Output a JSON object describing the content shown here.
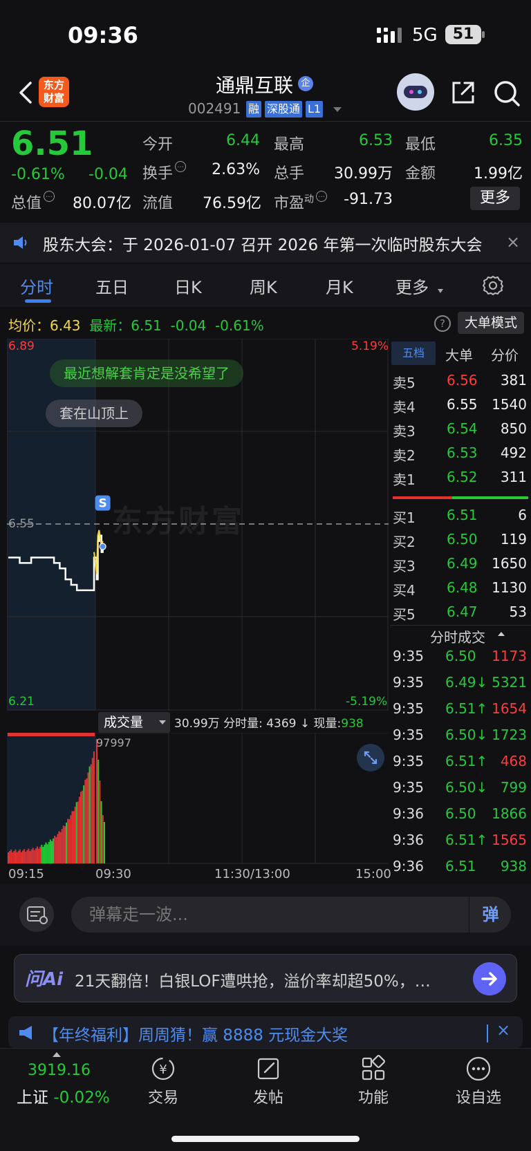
{
  "status_bar": {
    "time": "09:36",
    "network": "5G",
    "battery": "51"
  },
  "header": {
    "logo_line1": "东方",
    "logo_line2": "财富",
    "stock_name": "通鼎互联",
    "qi_badge": "企",
    "stock_code": "002491",
    "tags": [
      "融",
      "深股通",
      "L1"
    ]
  },
  "quote": {
    "price": "6.51",
    "change_pct": "-0.61%",
    "change_amt": "-0.04",
    "fields": [
      {
        "label": "今开",
        "value": "6.44",
        "color": "green"
      },
      {
        "label": "最高",
        "value": "6.53",
        "color": "green"
      },
      {
        "label": "最低",
        "value": "6.35",
        "color": "green"
      },
      {
        "label": "换手",
        "value": "2.63%",
        "color": "white"
      },
      {
        "label": "总手",
        "value": "30.99万",
        "color": "white"
      },
      {
        "label": "金额",
        "value": "1.99亿",
        "color": "white"
      },
      {
        "label": "总值",
        "value": "80.07亿",
        "color": "white"
      },
      {
        "label": "流值",
        "value": "76.59亿",
        "color": "white"
      },
      {
        "label": "市盈",
        "sup": "动",
        "value": "-91.73",
        "color": "white"
      }
    ],
    "more_label": "更多"
  },
  "notice": {
    "text": "股东大会：于 2026-01-07 召开 2026 年第一次临时股东大会",
    "close": "×"
  },
  "tabs": [
    "分时",
    "五日",
    "日K",
    "周K",
    "月K",
    "更多"
  ],
  "avg_line": {
    "avg_label": "均价：",
    "avg_value": "6.43",
    "latest_label": "最新：",
    "latest_value": "6.51",
    "latest_chg": "-0.04",
    "latest_pct": "-0.61%"
  },
  "help": "?",
  "big_order_mode": "大单模式",
  "chart_data": {
    "type": "line",
    "y_top": "6.89",
    "y_mid": "6.55",
    "y_bottom": "6.21",
    "pct_top": "5.19%",
    "pct_bottom": "-5.19%",
    "ylim": [
      6.21,
      6.89
    ],
    "prev_close": 6.55,
    "x_labels": [
      "09:15",
      "09:30",
      "11:30/13:00",
      "15:00"
    ],
    "marker": "S",
    "price_series": [
      {
        "t": "09:15",
        "v": 6.49
      },
      {
        "t": "09:17",
        "v": 6.48
      },
      {
        "t": "09:19",
        "v": 6.49
      },
      {
        "t": "09:21",
        "v": 6.49
      },
      {
        "t": "09:23",
        "v": 6.48
      },
      {
        "t": "09:24",
        "v": 6.47
      },
      {
        "t": "09:25",
        "v": 6.45
      },
      {
        "t": "09:26",
        "v": 6.44
      },
      {
        "t": "09:27",
        "v": 6.43
      },
      {
        "t": "09:28",
        "v": 6.43
      },
      {
        "t": "09:29",
        "v": 6.43
      },
      {
        "t": "09:30",
        "v": 6.49
      },
      {
        "t": "09:31",
        "v": 6.45
      },
      {
        "t": "09:32",
        "v": 6.52
      },
      {
        "t": "09:33",
        "v": 6.53
      },
      {
        "t": "09:35",
        "v": 6.5
      },
      {
        "t": "09:36",
        "v": 6.51
      }
    ]
  },
  "bubbles": [
    "最近想解套肯定是没希望了",
    "套在山顶上"
  ],
  "watermark": "东方财富",
  "volume": {
    "dropdown": "成交量",
    "total": "30.99万",
    "fenshi_label": "分时量:",
    "fenshi_value": "4369",
    "arrow": "↓",
    "now_label": "现量:",
    "now_value": "938",
    "max_label": "97997"
  },
  "right_panel": {
    "tabs": [
      "五档",
      "大单",
      "分价"
    ],
    "asks": [
      {
        "label": "卖5",
        "price": "6.56",
        "vol": "381",
        "color": "red"
      },
      {
        "label": "卖4",
        "price": "6.55",
        "vol": "1540",
        "color": "white"
      },
      {
        "label": "卖3",
        "price": "6.54",
        "vol": "850",
        "color": "green"
      },
      {
        "label": "卖2",
        "price": "6.53",
        "vol": "492",
        "color": "green"
      },
      {
        "label": "卖1",
        "price": "6.52",
        "vol": "311",
        "color": "green"
      }
    ],
    "bids": [
      {
        "label": "买1",
        "price": "6.51",
        "vol": "6",
        "color": "green"
      },
      {
        "label": "买2",
        "price": "6.50",
        "vol": "119",
        "color": "green"
      },
      {
        "label": "买3",
        "price": "6.49",
        "vol": "1650",
        "color": "green"
      },
      {
        "label": "买4",
        "price": "6.48",
        "vol": "1130",
        "color": "green"
      },
      {
        "label": "买5",
        "price": "6.47",
        "vol": "53",
        "color": "green"
      }
    ],
    "ticks_title": "分时成交",
    "ticks": [
      {
        "time": "9:35",
        "price": "6.50",
        "vol": "1173",
        "vol_color": "red"
      },
      {
        "time": "9:35",
        "price": "6.49↓",
        "vol": "5321",
        "vol_color": "green"
      },
      {
        "time": "9:35",
        "price": "6.51↑",
        "vol": "1654",
        "vol_color": "red"
      },
      {
        "time": "9:35",
        "price": "6.50↓",
        "vol": "1723",
        "vol_color": "green"
      },
      {
        "time": "9:35",
        "price": "6.51↑",
        "vol": "468",
        "vol_color": "red"
      },
      {
        "time": "9:35",
        "price": "6.50↓",
        "vol": "799",
        "vol_color": "green"
      },
      {
        "time": "9:36",
        "price": "6.50",
        "vol": "1866",
        "vol_color": "green"
      },
      {
        "time": "9:36",
        "price": "6.51↑",
        "vol": "1565",
        "vol_color": "red"
      },
      {
        "time": "9:36",
        "price": "6.51",
        "vol": "938",
        "vol_color": "green"
      }
    ]
  },
  "danmaku": {
    "placeholder": "弹幕走一波...",
    "send": "弹"
  },
  "ai_bar": {
    "logo": "问Ai",
    "text": "21天翻倍！白银LOF遭哄抢，溢价率却超50%，…"
  },
  "promo": {
    "text": "【年终福利】周周猜！赢 8888 元现金大奖",
    "close": "×"
  },
  "bottom_nav": {
    "index_value": "3919.16",
    "index_name": "上证",
    "index_pct": "-0.02%",
    "items": [
      "交易",
      "发帖",
      "功能",
      "设自选"
    ]
  },
  "colors": {
    "up": "#ff3b3b",
    "down": "#25c93a",
    "accent": "#4e8cf0"
  }
}
